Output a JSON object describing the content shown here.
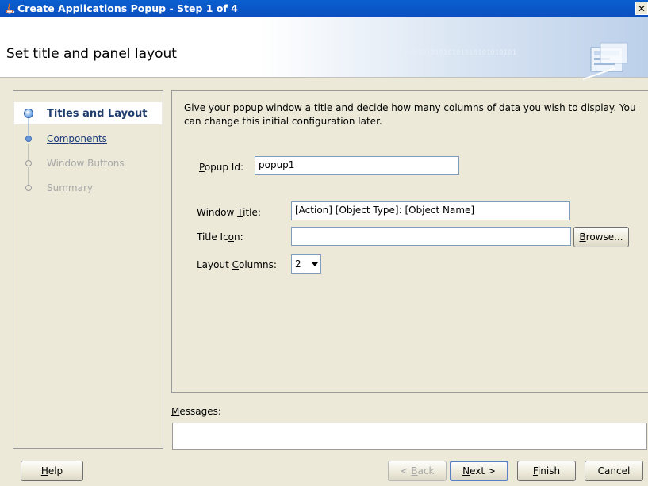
{
  "window": {
    "title": "Create Applications Popup - Step 1 of 4",
    "close_label": "✕"
  },
  "header": {
    "heading": "Set title and panel layout",
    "binary_text": "01010101010101010101010101"
  },
  "nav": {
    "steps": [
      {
        "label": "Titles and Layout",
        "state": "current"
      },
      {
        "label": "Components",
        "state": "link"
      },
      {
        "label": "Window Buttons",
        "state": "disabled"
      },
      {
        "label": "Summary",
        "state": "disabled"
      }
    ]
  },
  "content": {
    "intro": "Give your popup window a title and decide how many columns of data you wish to display. You can change this initial configuration later.",
    "popup_id": {
      "label_pre": "",
      "label_mn": "P",
      "label_post": "opup Id:",
      "value": "popup1"
    },
    "window_title": {
      "label_pre": "Window ",
      "label_mn": "T",
      "label_post": "itle:",
      "value": "[Action] [Object Type]: [Object Name]"
    },
    "title_icon": {
      "label_pre": "Title Ic",
      "label_mn": "o",
      "label_post": "n:",
      "value": "",
      "browse_label_pre": "",
      "browse_mn": "B",
      "browse_label_post": "rowse..."
    },
    "layout_columns": {
      "label_pre": "Layout ",
      "label_mn": "C",
      "label_post": "olumns:",
      "value": "2"
    }
  },
  "messages": {
    "label_pre": "",
    "label_mn": "M",
    "label_post": "essages:"
  },
  "footer": {
    "help": {
      "pre": "",
      "mn": "H",
      "post": "elp"
    },
    "back": {
      "pre": "< ",
      "mn": "B",
      "post": "ack"
    },
    "next": {
      "pre": "",
      "mn": "N",
      "post": "ext >"
    },
    "finish": {
      "pre": "",
      "mn": "F",
      "post": "inish"
    },
    "cancel": {
      "label": "Cancel"
    }
  },
  "colors": {
    "titlebar": "#0b55c8",
    "current_step": "#1f3d6f",
    "link": "#1c3a7a",
    "step_dot": "#6a9ad8"
  }
}
